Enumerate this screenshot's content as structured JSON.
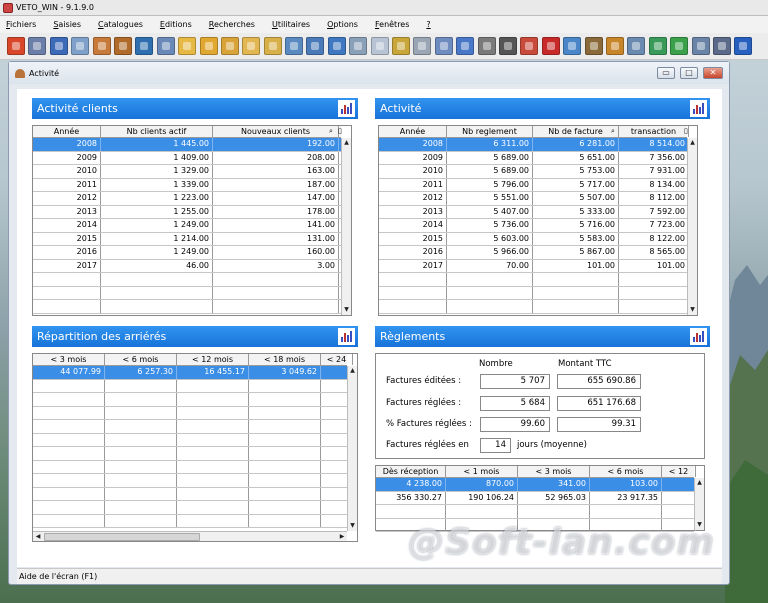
{
  "app": {
    "title": "VETO_WIN - 9.1.9.0"
  },
  "menu": {
    "items": [
      {
        "first": "F",
        "rest": "ichiers"
      },
      {
        "first": "S",
        "rest": "aisies"
      },
      {
        "first": "C",
        "rest": "atalogues"
      },
      {
        "first": "E",
        "rest": "ditions"
      },
      {
        "first": "R",
        "rest": "echerches"
      },
      {
        "first": "U",
        "rest": "tilitaires"
      },
      {
        "first": "O",
        "rest": "ptions"
      },
      {
        "first": "F",
        "rest": "enêtres"
      },
      {
        "first": "?",
        "rest": ""
      }
    ]
  },
  "toolbar": {
    "icons": [
      {
        "name": "power-icon",
        "color": "#d9472b"
      },
      {
        "name": "printer-icon",
        "color": "#6b7fa8"
      },
      {
        "name": "calculator-icon",
        "color": "#3e6bb8"
      },
      {
        "name": "cash-register-icon",
        "color": "#7fa0c8"
      },
      {
        "name": "clients-icon",
        "color": "#c87a3a"
      },
      {
        "name": "animals-icon",
        "color": "#b06a2a"
      },
      {
        "name": "globe-icon",
        "color": "#2f6fb0"
      },
      {
        "name": "documents-icon",
        "color": "#6a89b8"
      },
      {
        "name": "folder-icon",
        "color": "#e6b844"
      },
      {
        "name": "folder-open-icon",
        "color": "#e0a830"
      },
      {
        "name": "folder-edit-icon",
        "color": "#d8a43a"
      },
      {
        "name": "folder-note-icon",
        "color": "#e2b650"
      },
      {
        "name": "edit-icon",
        "color": "#d7b04a"
      },
      {
        "name": "network-icon",
        "color": "#5a8ac0"
      },
      {
        "name": "tree-icon",
        "color": "#4a7ab8"
      },
      {
        "name": "transfer-icon",
        "color": "#3f78c0"
      },
      {
        "name": "ticket-icon",
        "color": "#8aa0b8"
      },
      {
        "name": "envelope-icon",
        "color": "#b8c4d4"
      },
      {
        "name": "key-icon",
        "color": "#c9a63a"
      },
      {
        "name": "fax-icon",
        "color": "#9aa6b4"
      },
      {
        "name": "chart-icon",
        "color": "#6f8cc0"
      },
      {
        "name": "calendar-icon",
        "color": "#4a78c8"
      },
      {
        "name": "phone-icon",
        "color": "#7a7a7a"
      },
      {
        "name": "barcode-icon",
        "color": "#555555"
      },
      {
        "name": "scanner-icon",
        "color": "#c84a3a"
      },
      {
        "name": "heart-icon",
        "color": "#c82a2a"
      },
      {
        "name": "book-icon",
        "color": "#4a86c8"
      },
      {
        "name": "camera-icon",
        "color": "#8a6a3a"
      },
      {
        "name": "home-icon",
        "color": "#c8862a"
      },
      {
        "name": "id-card-icon",
        "color": "#6a8ab0"
      },
      {
        "name": "share-icon",
        "color": "#3a9a5a"
      },
      {
        "name": "mail-check-icon",
        "color": "#3aa04a"
      },
      {
        "name": "pen-icon",
        "color": "#6a84a8"
      },
      {
        "name": "date-icon",
        "color": "#5a6a88"
      },
      {
        "name": "help-icon",
        "color": "#2860c0"
      }
    ]
  },
  "window": {
    "title": "Activité",
    "btn_min": "▭",
    "btn_max": "□",
    "btn_close": "✕"
  },
  "panels": {
    "activite_clients": {
      "title": "Activité clients",
      "columns": [
        "Année",
        "Nb clients actif",
        "Nouveaux clients"
      ],
      "rows": [
        [
          "2008",
          "1 445.00",
          "192.00"
        ],
        [
          "2009",
          "1 409.00",
          "208.00"
        ],
        [
          "2010",
          "1 329.00",
          "163.00"
        ],
        [
          "2011",
          "1 339.00",
          "187.00"
        ],
        [
          "2012",
          "1 223.00",
          "147.00"
        ],
        [
          "2013",
          "1 255.00",
          "178.00"
        ],
        [
          "2014",
          "1 249.00",
          "141.00"
        ],
        [
          "2015",
          "1 214.00",
          "131.00"
        ],
        [
          "2016",
          "1 249.00",
          "160.00"
        ],
        [
          "2017",
          "46.00",
          "3.00"
        ]
      ],
      "blank_rows": 3
    },
    "activite": {
      "title": "Activité",
      "columns": [
        "Année",
        "Nb reglement",
        "Nb de facture",
        "transaction"
      ],
      "rows": [
        [
          "2008",
          "6 311.00",
          "6 281.00",
          "8 514.00"
        ],
        [
          "2009",
          "5 689.00",
          "5 651.00",
          "7 356.00"
        ],
        [
          "2010",
          "5 689.00",
          "5 753.00",
          "7 931.00"
        ],
        [
          "2011",
          "5 796.00",
          "5 717.00",
          "8 134.00"
        ],
        [
          "2012",
          "5 551.00",
          "5 507.00",
          "8 112.00"
        ],
        [
          "2013",
          "5 407.00",
          "5 333.00",
          "7 592.00"
        ],
        [
          "2014",
          "5 736.00",
          "5 716.00",
          "7 723.00"
        ],
        [
          "2015",
          "5 603.00",
          "5 583.00",
          "8 122.00"
        ],
        [
          "2016",
          "5 966.00",
          "5 867.00",
          "8 565.00"
        ],
        [
          "2017",
          "70.00",
          "101.00",
          "101.00"
        ]
      ],
      "blank_rows": 3
    },
    "arrieres": {
      "title": "Répartition des arriérés",
      "columns": [
        "< 3 mois",
        "< 6 mois",
        "< 12 mois",
        "< 18 mois",
        "< 24"
      ],
      "rows": [
        [
          "44 077.99",
          "6 257.30",
          "16 455.17",
          "3 049.62",
          ""
        ]
      ],
      "blank_rows": 11
    },
    "reglements": {
      "title": "Règlements",
      "col_nombre": "Nombre",
      "col_montant": "Montant TTC",
      "lbl_editees": "Factures éditées :",
      "editees_nb": "5 707",
      "editees_mt": "655 690.86",
      "lbl_reglees": "Factures réglées :",
      "reglees_nb": "5 684",
      "reglees_mt": "651 176.68",
      "lbl_pct": "% Factures réglées :",
      "pct_nb": "99.60",
      "pct_mt": "99.31",
      "lbl_en": "Factures réglées en",
      "jours": "14",
      "lbl_jours": "jours (moyenne)",
      "columns": [
        "Dès réception",
        "< 1 mois",
        "< 3 mois",
        "< 6 mois",
        "< 12"
      ],
      "rows": [
        [
          "4 238.00",
          "870.00",
          "341.00",
          "103.00",
          ""
        ],
        [
          "356 330.27",
          "190 106.24",
          "52 965.03",
          "23 917.35",
          ""
        ]
      ],
      "blank_rows": 2
    }
  },
  "status": {
    "text": "Aide de l'écran (F1)"
  },
  "watermark": {
    "text": "@Soft-lan.com"
  }
}
